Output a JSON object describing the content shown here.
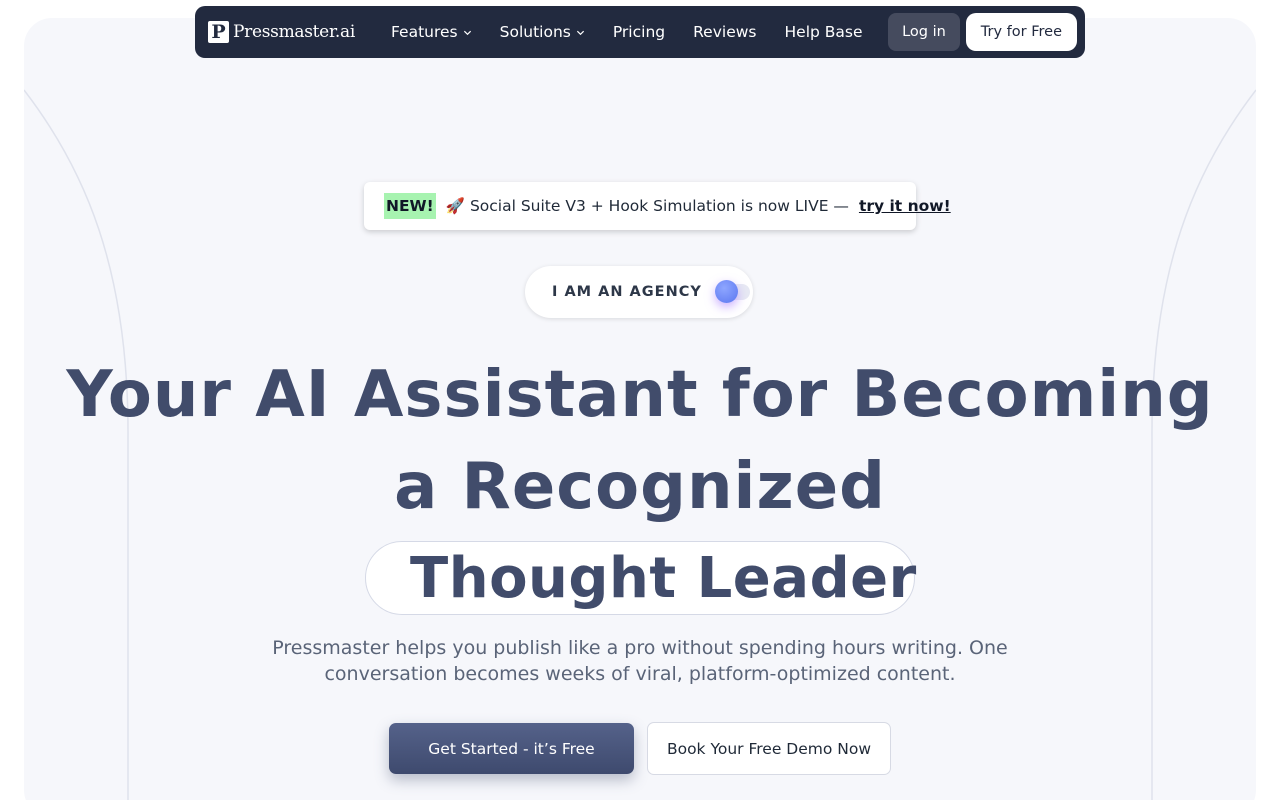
{
  "navbar": {
    "logo_mark": "P",
    "logo_text": "Pressmaster.ai",
    "links": [
      {
        "label": "Features",
        "has_dropdown": true
      },
      {
        "label": "Solutions",
        "has_dropdown": true
      },
      {
        "label": "Pricing",
        "has_dropdown": false
      },
      {
        "label": "Reviews",
        "has_dropdown": false
      },
      {
        "label": "Help Base",
        "has_dropdown": false
      }
    ],
    "login_label": "Log in",
    "try_label": "Try for Free",
    "background_color": "#222a3f"
  },
  "announcement": {
    "badge": "NEW!",
    "icon": "rocket-icon",
    "text": "🚀 Social Suite V3 + Hook Simulation is now LIVE —",
    "link_label": "try it now!",
    "badge_color": "#a7f3b0"
  },
  "audience_toggle": {
    "label": "I AM AN AGENCY",
    "is_on": false
  },
  "hero": {
    "headline_line1": "Your AI Assistant for Becoming",
    "headline_line2": "a Recognized",
    "headline_highlight": "Thought Leader",
    "highlight_icon": "verified-badge-icon",
    "subtitle_line1": "Pressmaster helps you publish like a pro without spending hours writing. One",
    "subtitle_line2": "conversation becomes weeks of viral, platform-optimized content.",
    "headline_color": "#414c6b"
  },
  "cta": {
    "primary_label": "Get Started - it’s Free",
    "secondary_label": "Book Your Free Demo Now"
  }
}
